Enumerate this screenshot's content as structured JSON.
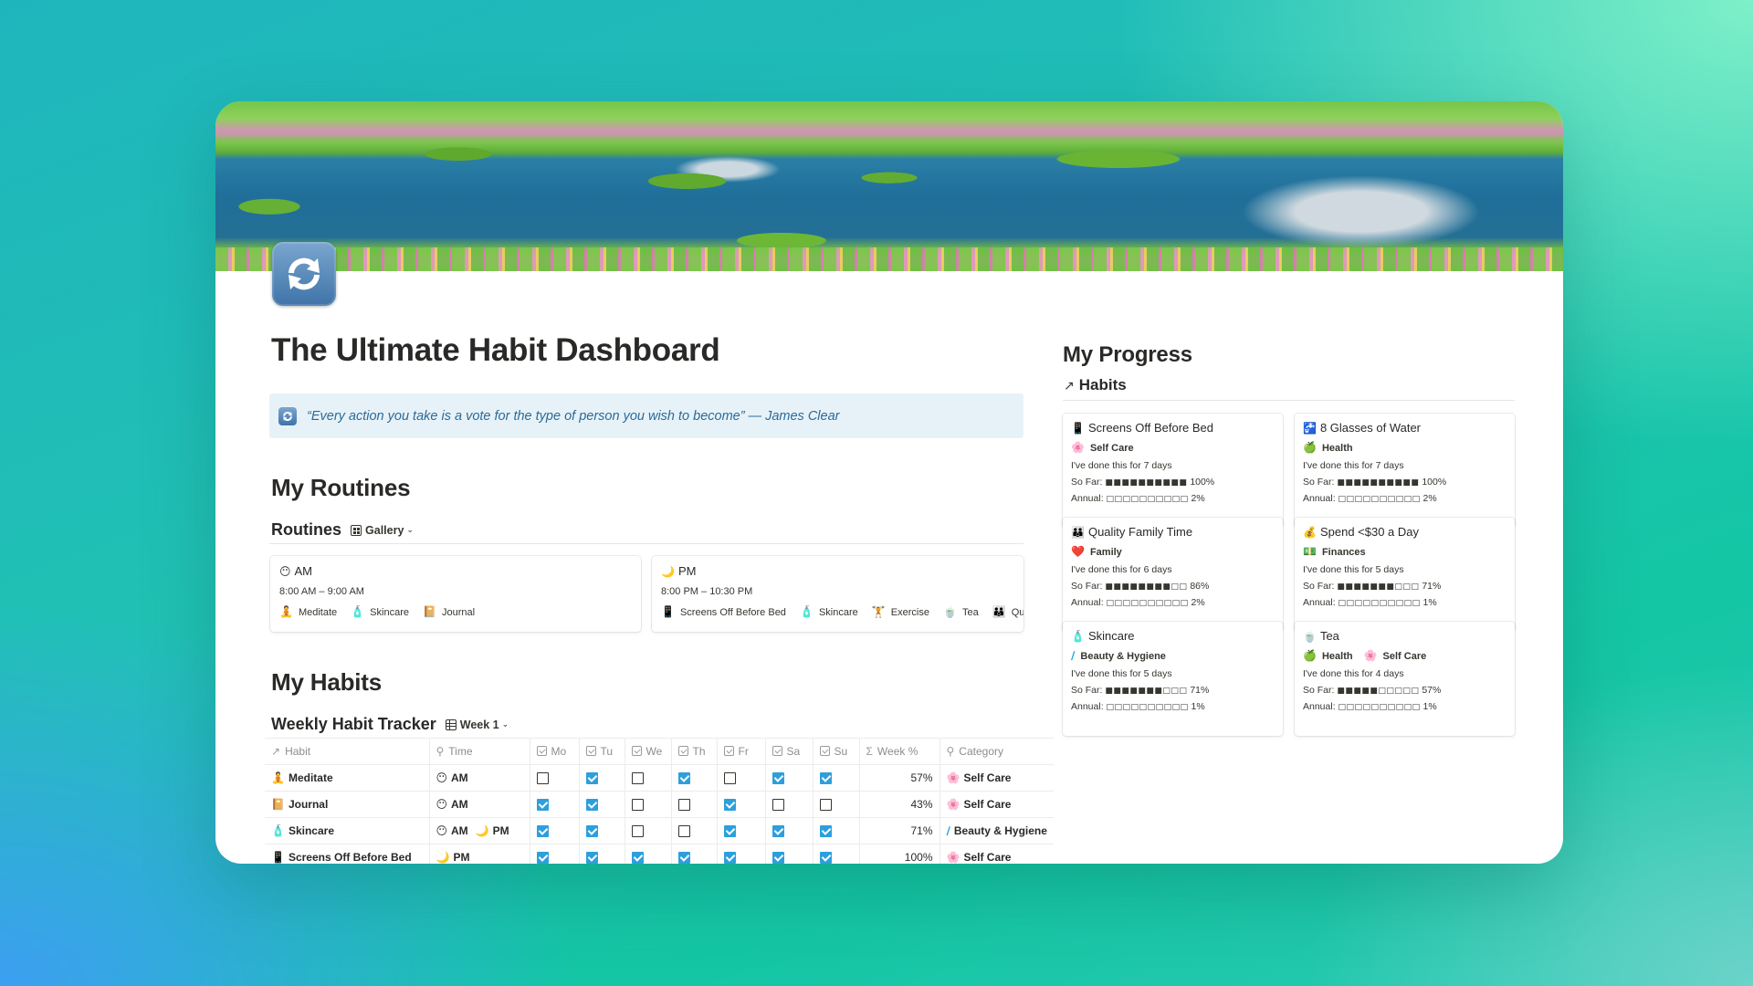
{
  "page": {
    "title": "The Ultimate Habit Dashboard",
    "icon": "repeat-arrows-icon",
    "quote": "“Every action you take is a vote for the type of person you wish to become” — James Clear"
  },
  "routines_section": {
    "heading": "My Routines",
    "db_title": "Routines",
    "view_label": "Gallery",
    "cards": [
      {
        "emoji": "😶",
        "title": "AM",
        "time": "8:00 AM – 9:00 AM",
        "habits": [
          {
            "emoji": "🧘",
            "label": "Meditate"
          },
          {
            "emoji": "🧴",
            "label": "Skincare"
          },
          {
            "emoji": "📔",
            "label": "Journal"
          }
        ]
      },
      {
        "emoji": "🌙",
        "title": "PM",
        "time": "8:00 PM – 10:30 PM",
        "habits": [
          {
            "emoji": "📱",
            "label": "Screens Off Before Bed"
          },
          {
            "emoji": "🧴",
            "label": "Skincare"
          },
          {
            "emoji": "🏋",
            "label": "Exercise"
          },
          {
            "emoji": "🍵",
            "label": "Tea"
          },
          {
            "emoji": "👪",
            "label": "Quality Fam"
          }
        ]
      }
    ]
  },
  "habits_section": {
    "heading": "My Habits",
    "db_title": "Weekly Habit Tracker",
    "view_label": "Week 1",
    "columns": {
      "habit": "Habit",
      "time": "Time",
      "days": [
        "Mo",
        "Tu",
        "We",
        "Th",
        "Fr",
        "Sa",
        "Su"
      ],
      "week_pct": "Week %",
      "category": "Category"
    },
    "rows": [
      {
        "emoji": "🧘",
        "habit": "Meditate",
        "time": [
          {
            "emoji": "😶",
            "label": "AM"
          }
        ],
        "days": [
          false,
          true,
          false,
          true,
          false,
          true,
          true
        ],
        "week_pct": "57%",
        "category": {
          "emoji": "🌸",
          "label": "Self Care"
        }
      },
      {
        "emoji": "📔",
        "habit": "Journal",
        "time": [
          {
            "emoji": "😶",
            "label": "AM"
          }
        ],
        "days": [
          true,
          true,
          false,
          false,
          true,
          false,
          false
        ],
        "week_pct": "43%",
        "category": {
          "emoji": "🌸",
          "label": "Self Care"
        }
      },
      {
        "emoji": "🧴",
        "habit": "Skincare",
        "time": [
          {
            "emoji": "😶",
            "label": "AM"
          },
          {
            "emoji": "🌙",
            "label": "PM"
          }
        ],
        "days": [
          true,
          true,
          false,
          false,
          true,
          true,
          true
        ],
        "week_pct": "71%",
        "category": {
          "emoji": "∕",
          "label": "Beauty & Hygiene"
        }
      },
      {
        "emoji": "📱",
        "habit": "Screens Off Before Bed",
        "time": [
          {
            "emoji": "🌙",
            "label": "PM"
          }
        ],
        "days": [
          true,
          true,
          true,
          true,
          true,
          true,
          true
        ],
        "week_pct": "100%",
        "category": {
          "emoji": "🌸",
          "label": "Self Care"
        }
      }
    ]
  },
  "progress_section": {
    "heading": "My Progress",
    "db_title": "Habits",
    "so_far_label": "So Far:",
    "annual_label": "Annual:",
    "cards": [
      {
        "emoji": "📱",
        "title": "Screens Off Before Bed",
        "categories": [
          {
            "emoji": "🌸",
            "label": "Self Care"
          }
        ],
        "days_text": "I've done this for 7 days",
        "so_far_bar": "■■■■■■■■■■",
        "so_far_pct": "100%",
        "annual_bar": "□□□□□□□□□□",
        "annual_pct": "2%"
      },
      {
        "emoji": "🚰",
        "title": "8 Glasses of Water",
        "categories": [
          {
            "emoji": "🍏",
            "label": "Health"
          }
        ],
        "days_text": "I've done this for 7 days",
        "so_far_bar": "■■■■■■■■■■",
        "so_far_pct": "100%",
        "annual_bar": "□□□□□□□□□□",
        "annual_pct": "2%"
      },
      {
        "emoji": "👪",
        "title": "Quality Family Time",
        "categories": [
          {
            "emoji": "❤️",
            "label": "Family"
          }
        ],
        "days_text": "I've done this for 6 days",
        "so_far_bar": "■■■■■■■■□□",
        "so_far_pct": "86%",
        "annual_bar": "□□□□□□□□□□",
        "annual_pct": "2%"
      },
      {
        "emoji": "💰",
        "title": "Spend <$30 a Day",
        "categories": [
          {
            "emoji": "💵",
            "label": "Finances"
          }
        ],
        "days_text": "I've done this for 5 days",
        "so_far_bar": "■■■■■■■□□□",
        "so_far_pct": "71%",
        "annual_bar": "□□□□□□□□□□",
        "annual_pct": "1%"
      },
      {
        "emoji": "🧴",
        "title": "Skincare",
        "categories": [
          {
            "emoji": "∕",
            "label": "Beauty & Hygiene"
          }
        ],
        "days_text": "I've done this for 5 days",
        "so_far_bar": "■■■■■■■□□□",
        "so_far_pct": "71%",
        "annual_bar": "□□□□□□□□□□",
        "annual_pct": "1%"
      },
      {
        "emoji": "🍵",
        "title": "Tea",
        "categories": [
          {
            "emoji": "🍏",
            "label": "Health"
          },
          {
            "emoji": "🌸",
            "label": "Self Care"
          }
        ],
        "days_text": "I've done this for 4 days",
        "so_far_bar": "■■■■■□□□□□",
        "so_far_pct": "57%",
        "annual_bar": "□□□□□□□□□□",
        "annual_pct": "1%"
      }
    ]
  },
  "colors": {
    "checkbox_on": "#2d9fdc",
    "callout_bg": "#e7f2f8",
    "callout_text": "#2b6a97"
  }
}
